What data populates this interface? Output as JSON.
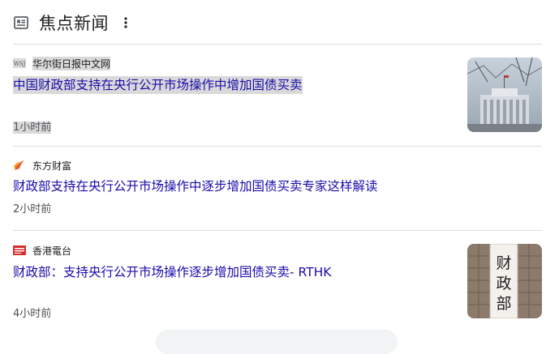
{
  "header": {
    "title": "焦点新闻",
    "icon": "newspaper-icon",
    "more_icon": "more-vert-icon"
  },
  "items": [
    {
      "source": "华尔街日报中文网",
      "logo": "WSJ",
      "headline": "中国财政部支持在央行公开市场操作中增加国债买卖",
      "time": "1小时前"
    },
    {
      "source": "东方财富",
      "logo": "eastmoney-logo",
      "headline": "财政部支持在央行公开市场操作中逐步增加国债买卖专家这样解读",
      "time": "2小时前"
    },
    {
      "source": "香港電台",
      "logo": "rthk-logo",
      "headline": "财政部：支持央行公开市场操作逐步增加国债买卖- RTHK",
      "time": "4小时前"
    }
  ],
  "thumb_text": "财政部"
}
